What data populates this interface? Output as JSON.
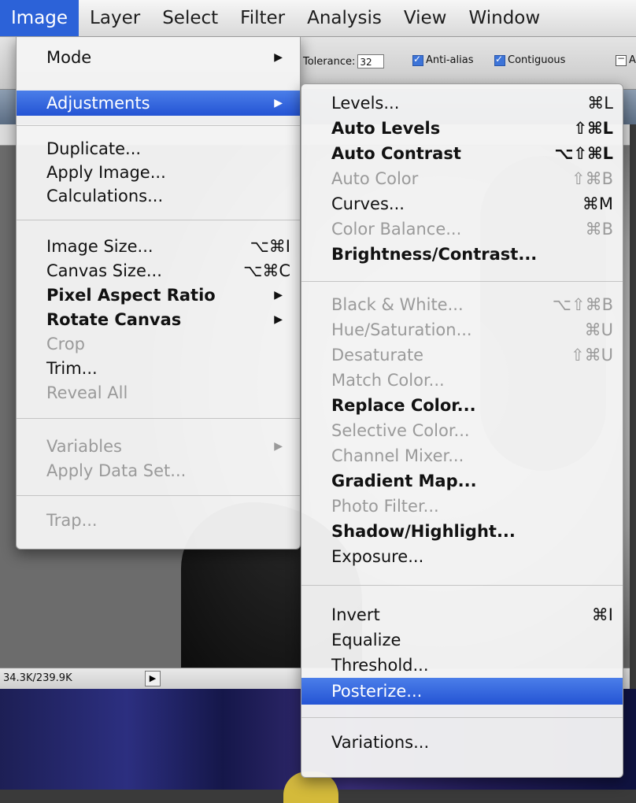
{
  "menubar": {
    "items": [
      "Image",
      "Layer",
      "Select",
      "Filter",
      "Analysis",
      "View",
      "Window"
    ],
    "active": "Image"
  },
  "options_bar": {
    "tolerance_label": "Tolerance:",
    "tolerance_value": "32",
    "anti_alias_label": "Anti-alias",
    "contiguous_label": "Contiguous",
    "all_layers_label": "A"
  },
  "status_bar": {
    "doc_size": "34.3K/239.9K"
  },
  "image_menu": {
    "items": [
      {
        "label": "Mode",
        "submenu": true
      },
      {
        "label": "Adjustments",
        "submenu": true,
        "highlighted": true
      },
      {
        "label": "Duplicate..."
      },
      {
        "label": "Apply Image..."
      },
      {
        "label": "Calculations..."
      },
      {
        "label": "Image Size...",
        "shortcut": "⌥⌘I"
      },
      {
        "label": "Canvas Size...",
        "shortcut": "⌥⌘C"
      },
      {
        "label": "Pixel Aspect Ratio",
        "submenu": true
      },
      {
        "label": "Rotate Canvas",
        "submenu": true
      },
      {
        "label": "Crop",
        "disabled": true
      },
      {
        "label": "Trim..."
      },
      {
        "label": "Reveal All",
        "disabled": true
      },
      {
        "label": "Variables",
        "submenu": true,
        "disabled": true
      },
      {
        "label": "Apply Data Set...",
        "disabled": true
      },
      {
        "label": "Trap...",
        "disabled": true
      }
    ]
  },
  "adjustments_menu": {
    "items": [
      {
        "label": "Levels...",
        "shortcut": "⌘L"
      },
      {
        "label": "Auto Levels",
        "shortcut": "⇧⌘L"
      },
      {
        "label": "Auto Contrast",
        "shortcut": "⌥⇧⌘L"
      },
      {
        "label": "Auto Color",
        "shortcut": "⇧⌘B",
        "disabled": true
      },
      {
        "label": "Curves...",
        "shortcut": "⌘M"
      },
      {
        "label": "Color Balance...",
        "shortcut": "⌘B",
        "disabled": true
      },
      {
        "label": "Brightness/Contrast..."
      },
      {
        "label": "Black & White...",
        "shortcut": "⌥⇧⌘B",
        "disabled": true
      },
      {
        "label": "Hue/Saturation...",
        "shortcut": "⌘U",
        "disabled": true
      },
      {
        "label": "Desaturate",
        "shortcut": "⇧⌘U",
        "disabled": true
      },
      {
        "label": "Match Color...",
        "disabled": true
      },
      {
        "label": "Replace Color..."
      },
      {
        "label": "Selective Color...",
        "disabled": true
      },
      {
        "label": "Channel Mixer...",
        "disabled": true
      },
      {
        "label": "Gradient Map..."
      },
      {
        "label": "Photo Filter...",
        "disabled": true
      },
      {
        "label": "Shadow/Highlight..."
      },
      {
        "label": "Exposure..."
      },
      {
        "label": "Invert",
        "shortcut": "⌘I"
      },
      {
        "label": "Equalize"
      },
      {
        "label": "Threshold..."
      },
      {
        "label": "Posterize...",
        "highlighted": true
      },
      {
        "label": "Variations..."
      }
    ]
  },
  "colors": {
    "highlight": "#2c62d8",
    "disabled_text": "#9a9a9a"
  }
}
